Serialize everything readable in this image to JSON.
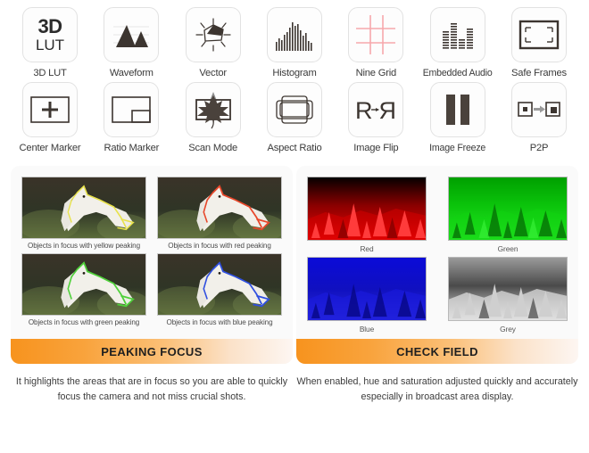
{
  "icon_grid": {
    "row1": [
      {
        "label": "3D LUT",
        "icon": "3d-lut-icon",
        "glyph_top": "3D",
        "glyph_bottom": "LUT"
      },
      {
        "label": "Waveform",
        "icon": "waveform-icon"
      },
      {
        "label": "Vector",
        "icon": "vector-scope-icon"
      },
      {
        "label": "Histogram",
        "icon": "histogram-icon"
      },
      {
        "label": "Nine Grid",
        "icon": "nine-grid-icon"
      },
      {
        "label": "Embedded Audio",
        "icon": "embedded-audio-icon"
      },
      {
        "label": "Safe Frames",
        "icon": "safe-frames-icon"
      }
    ],
    "row2": [
      {
        "label": "Center Marker",
        "icon": "center-marker-icon"
      },
      {
        "label": "Ratio Marker",
        "icon": "ratio-marker-icon"
      },
      {
        "label": "Scan Mode",
        "icon": "scan-mode-icon"
      },
      {
        "label": "Aspect Ratio",
        "icon": "aspect-ratio-icon"
      },
      {
        "label": "Image Flip",
        "icon": "image-flip-icon"
      },
      {
        "label": "Image Freeze",
        "icon": "image-freeze-icon"
      },
      {
        "label": "P2P",
        "icon": "p2p-icon"
      }
    ]
  },
  "panels": [
    {
      "id": "peaking-focus",
      "banner": "PEAKING FOCUS",
      "thumbs": [
        {
          "caption": "Objects in focus with yellow peaking",
          "peak_color": "#e8e24a"
        },
        {
          "caption": "Objects in focus with red peaking",
          "peak_color": "#e8472a"
        },
        {
          "caption": "Objects in focus with green peaking",
          "peak_color": "#4fd13a"
        },
        {
          "caption": "Objects in focus with blue peaking",
          "peak_color": "#2f4fe0"
        }
      ],
      "description": "It highlights the areas that are in focus so you are able to quickly focus the camera and not miss crucial shots."
    },
    {
      "id": "check-field",
      "banner": "CHECK FIELD",
      "thumbs": [
        {
          "caption": "Red",
          "field_color": "#e00000"
        },
        {
          "caption": "Green",
          "field_color": "#12c412"
        },
        {
          "caption": "Blue",
          "field_color": "#1414e6"
        },
        {
          "caption": "Grey",
          "field_color": "#d0d0d0"
        }
      ],
      "description": "When enabled,  hue and saturation adjusted quickly and accurately especially in broadcast area display."
    }
  ],
  "colors": {
    "banner_start": "#f7931e",
    "banner_end": "#fdf6f2",
    "icon_dark": "#3c3530",
    "nine_grid_pink": "#f7a8ac",
    "panel_bg": "#fafafa"
  }
}
